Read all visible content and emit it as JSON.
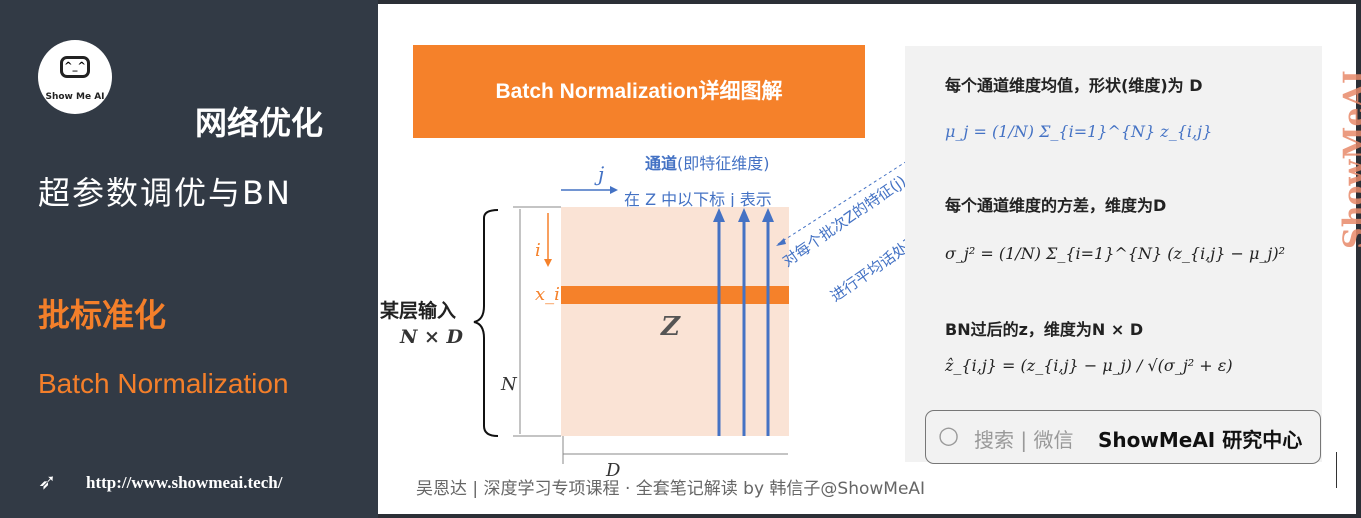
{
  "sidebar": {
    "logo_text": "Show Me AI",
    "logo_face": "^_^",
    "title1": "网络优化",
    "title2": "超参数调优与BN",
    "section_cn": "批标准化",
    "section_en": "Batch Normalization",
    "url": "http://www.showmeai.tech/"
  },
  "slide": {
    "banner": "Batch Normalization详细图解",
    "channel_label_bold": "通道",
    "channel_label_rest": "(即特征维度)",
    "j_label": "j",
    "j_desc": "在 Z 中以下标 j 表示",
    "i_label": "i",
    "xi_label": "x_i",
    "z_label": "Z",
    "n_label": "N",
    "d_label": "D",
    "layer_input": "某层输入",
    "layer_dims": "N × D",
    "diag_note1": "对每个批次Z的特征(j)",
    "diag_note2": "进行平均话处理",
    "mean_heading": "每个通道维度均值，形状(维度)为  D",
    "mean_formula": "μ_j = (1/N) Σ_{i=1}^{N} z_{i,j}",
    "var_heading": "每个通道维度的方差，维度为D",
    "var_formula": "σ_j² = (1/N) Σ_{i=1}^{N} (z_{i,j} − μ_j)²",
    "bn_heading": "BN过后的z，维度为N × D",
    "bn_formula": "ẑ_{i,j} = (z_{i,j} − μ_j) / √(σ_j² + ε)",
    "watermark": "ShowMeAI",
    "search_hint": "搜索 | 微信",
    "search_brand": "ShowMeAI 研究中心",
    "footer": "吴恩达 | 深度学习专项课程 · 全套笔记解读  by 韩信子@ShowMeAI"
  },
  "colors": {
    "accent": "#f5812a",
    "blue": "#4472c4",
    "sidebar": "#323a45",
    "matrix": "#fae3d5"
  }
}
